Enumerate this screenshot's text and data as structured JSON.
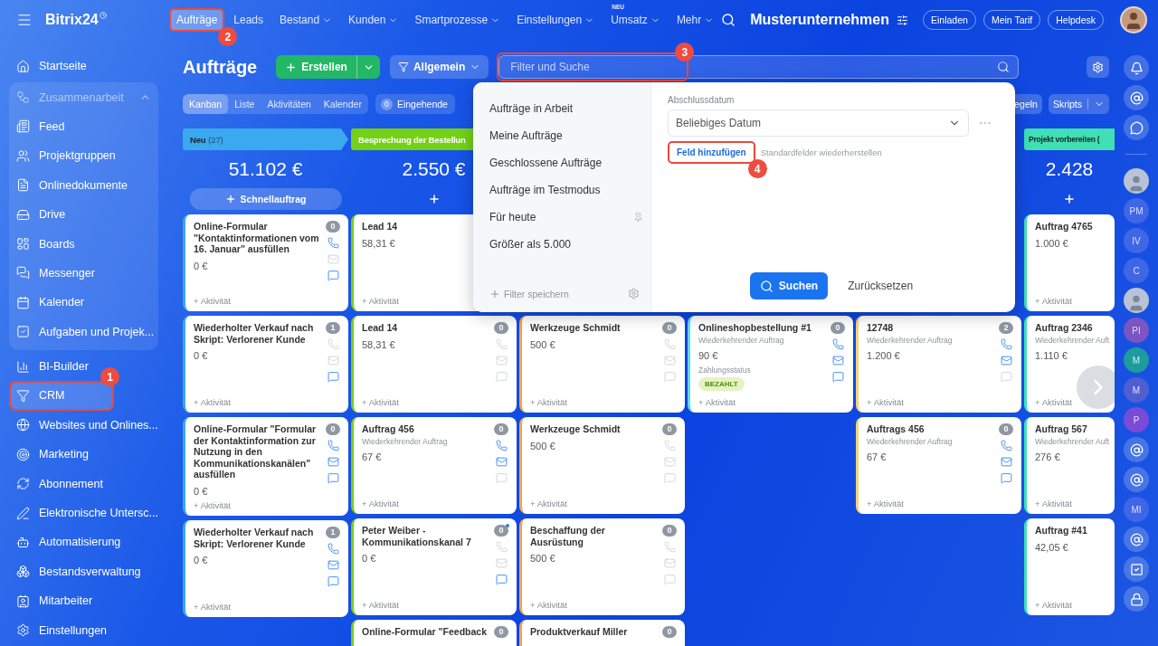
{
  "topbar": {
    "logo": "Bitrix24",
    "nav": [
      {
        "label": "Aufträge",
        "selected": true,
        "dropdown": false,
        "callout": "2"
      },
      {
        "label": "Leads",
        "selected": false,
        "dropdown": false
      },
      {
        "label": "Bestand",
        "selected": false,
        "dropdown": true
      },
      {
        "label": "Kunden",
        "selected": false,
        "dropdown": true
      },
      {
        "label": "Smartprozesse",
        "selected": false,
        "dropdown": true
      },
      {
        "label": "Einstellungen",
        "selected": false,
        "dropdown": true
      },
      {
        "label": "Umsatz",
        "selected": false,
        "dropdown": true,
        "badge": "NEU"
      },
      {
        "label": "Mehr",
        "selected": false,
        "dropdown": true
      }
    ],
    "company": "Musterunternehmen",
    "buttons": [
      "Einladen",
      "Mein Tarif",
      "Helpdesk"
    ]
  },
  "sidebar": {
    "items": [
      {
        "kind": "item",
        "label": "Startseite",
        "selected": false
      },
      {
        "kind": "group",
        "label": "Zusammenarbeit",
        "expanded": true,
        "children": [
          {
            "label": "Feed",
            "selected": false
          },
          {
            "label": "Projektgruppen",
            "selected": false
          },
          {
            "label": "Onlinedokumente",
            "selected": false
          },
          {
            "label": "Drive",
            "selected": false
          },
          {
            "label": "Boards",
            "selected": false
          },
          {
            "label": "Messenger",
            "selected": false
          },
          {
            "label": "Kalender",
            "selected": false
          },
          {
            "label": "Aufgaben und Projek...",
            "selected": false
          }
        ]
      },
      {
        "kind": "item",
        "label": "BI-Builder",
        "selected": false
      },
      {
        "kind": "item",
        "label": "CRM",
        "selected": true,
        "callout": "1"
      },
      {
        "kind": "item",
        "label": "Websites und Onlines...",
        "selected": false
      },
      {
        "kind": "item",
        "label": "Marketing",
        "selected": false
      },
      {
        "kind": "item",
        "label": "Abonnement",
        "selected": false
      },
      {
        "kind": "item",
        "label": "Elektronische Untersc...",
        "selected": false
      },
      {
        "kind": "item",
        "label": "Automatisierung",
        "selected": false
      },
      {
        "kind": "item",
        "label": "Bestandsverwaltung",
        "selected": false
      },
      {
        "kind": "item",
        "label": "Mitarbeiter",
        "selected": false
      },
      {
        "kind": "item",
        "label": "Einstellungen",
        "selected": false
      }
    ]
  },
  "header": {
    "title": "Aufträge",
    "create": "Erstellen",
    "preset": "Allgemein",
    "search": {
      "placeholder": "Filter und Suche",
      "callout": "3"
    }
  },
  "views": [
    {
      "label": "Kanban",
      "selected": true
    },
    {
      "label": "Liste",
      "selected": false
    },
    {
      "label": "Aktivitäten",
      "selected": false
    },
    {
      "label": "Kalender",
      "selected": false
    }
  ],
  "counters": [
    {
      "count": "0",
      "label": "Eingehende"
    }
  ],
  "right_buttons": [
    {
      "label": "egeln",
      "split": false
    },
    {
      "label": "Skripts",
      "split": true
    }
  ],
  "filter_popup": {
    "presets": [
      {
        "label": "Aufträge in Arbeit",
        "pinned": false
      },
      {
        "label": "Meine Aufträge",
        "pinned": false
      },
      {
        "label": "Geschlossene Aufträge",
        "pinned": false
      },
      {
        "label": "Aufträge im Testmodus",
        "pinned": false
      },
      {
        "label": "Für heute",
        "pinned": true
      },
      {
        "label": "Größer als 5.000",
        "pinned": false
      }
    ],
    "save": "Filter speichern",
    "field": {
      "label": "Abschlussdatum",
      "value": "Beliebiges Datum"
    },
    "add_field": {
      "label": "Feld hinzufügen",
      "callout": "4"
    },
    "restore": "Standardfelder wiederherstellen",
    "search_button": "Suchen",
    "reset_button": "Zurücksetzen"
  },
  "columns": [
    {
      "header": {
        "title": "Neu",
        "count": "(27)",
        "dark_text": true
      },
      "color": "#3aa9ef",
      "total": "51.102 €",
      "add_label": "Schnellauftrag",
      "cards": [
        {
          "title": "Online-Formular \"Kontaktinformationen vom 16. Januar\" ausfüllen",
          "amount": "0 €",
          "count": "0",
          "phone": true,
          "mail": false,
          "chat": true,
          "activity": "+ Aktivität"
        },
        {
          "title": "Wiederholter Verkauf nach Skript: Verlorener Kunde",
          "amount": "0 €",
          "count": "1",
          "phone": false,
          "mail": false,
          "chat": true,
          "activity": "+ Aktivität"
        },
        {
          "title": "Online-Formular \"Formular der Kontaktinformation zur Nutzung in den Kommunikationskanälen\" ausfüllen",
          "amount": "0 €",
          "count": "0",
          "phone": true,
          "mail": true,
          "chat": true,
          "activity": "+ Aktivität"
        },
        {
          "title": "Wiederholter Verkauf nach Skript: Verlorener Kunde",
          "amount": "0 €",
          "count": "1",
          "phone": true,
          "mail": true,
          "chat": true,
          "activity": "+ Aktivität"
        }
      ]
    },
    {
      "header": {
        "title": "Besprechung der Bestellun",
        "dark_text": false
      },
      "color": "#74d116",
      "total": "2.550 €",
      "cards": [
        {
          "title": "Lead 14",
          "amount": "58,31 €",
          "activity": "+ Aktivität"
        },
        {
          "title": "Lead 14",
          "amount": "58,31 €",
          "count": "0",
          "phone": false,
          "mail": false,
          "chat": false,
          "activity": "+ Aktivität"
        },
        {
          "title": "Auftrag 456",
          "subtitle": "Wiederkehrender Auftrag",
          "amount": "67 €",
          "count": "0",
          "phone": true,
          "mail": true,
          "chat": false,
          "activity": "+ Aktivität"
        },
        {
          "title": "Peter Weiber - Kommunikationskanal 7",
          "amount": "0 €",
          "count": "0",
          "unread": true,
          "phone": false,
          "mail": false,
          "chat": true,
          "activity": "+ Aktivität"
        },
        {
          "title": "Online-Formular \"Feedback",
          "count": "0"
        }
      ]
    },
    {
      "color": "#f5a348",
      "cards": [
        {
          "title": "Werkzeuge Schmidt",
          "amount": "500 €",
          "count": "0",
          "phone": false,
          "mail": false,
          "chat": false,
          "activity": "+ Aktivität"
        },
        {
          "title": "Werkzeuge Schmidt",
          "amount": "500 €",
          "count": "0",
          "phone": false,
          "mail": false,
          "chat": false,
          "activity": "+ Aktivität"
        },
        {
          "title": "Beschaffung der Ausrüstung",
          "amount": "500 €",
          "count": "0",
          "phone": false,
          "mail": false,
          "chat": false,
          "activity": "+ Aktivität"
        },
        {
          "title": "Produktverkauf Miller",
          "count": "0"
        }
      ]
    },
    {
      "color": "#62d8f4",
      "cards": [
        {
          "title": "Onlineshopbestellung #1",
          "subtitle": "Wiederkehrender Auftrag",
          "amount": "90 €",
          "status": {
            "label": "Zahlungsstatus",
            "badge": "BEZAHLT"
          },
          "count": "0",
          "phone": true,
          "mail": true,
          "chat": true,
          "activity": "+ Aktivität"
        }
      ]
    },
    {
      "color": "#f3d27a",
      "cards": [
        {
          "title": "12748",
          "subtitle": "Wiederkehrender Auftrag",
          "amount": "1.200 €",
          "count": "2",
          "phone": true,
          "mail": true,
          "chat": false,
          "activity": "+ Aktivität"
        },
        {
          "title": "Auftrags 456",
          "subtitle": "Wiederkehrender Auftrag",
          "amount": "67 €",
          "count": "0",
          "phone": true,
          "mail": true,
          "chat": true,
          "activity": "+ Aktivität"
        }
      ]
    },
    {
      "header": {
        "title": "Projekt vorbereiten (",
        "dark_text": true
      },
      "color": "#3ee0b4",
      "total": "2.428",
      "cards": [
        {
          "title": "Auftrag 4765",
          "amount": "1.000 €",
          "activity": "+ Aktivität"
        },
        {
          "title": "Auftrag 2346",
          "subtitle": "Wiederkehrender Auft",
          "amount": "1.110 €",
          "activity": "+ Aktivität"
        },
        {
          "title": "Auftrag 567",
          "subtitle": "Wiederkehrender Auft",
          "amount": "276 €",
          "activity": "+ Aktivität"
        },
        {
          "title": "Auftrag #41",
          "amount": "42,05 €",
          "activity": "+ Aktivität"
        }
      ]
    }
  ],
  "right_rail": [
    {
      "kind": "icon"
    },
    {
      "kind": "icon"
    },
    {
      "kind": "icon"
    },
    {
      "kind": "photo"
    },
    {
      "kind": "initials",
      "text": "PM",
      "color": "#3f66e6"
    },
    {
      "kind": "initials",
      "text": "IV",
      "color": "#3f66e6"
    },
    {
      "kind": "initials",
      "text": "C",
      "color": "#3f66e6"
    },
    {
      "kind": "photo"
    },
    {
      "kind": "initials",
      "text": "PI",
      "color": "#7c55c4"
    },
    {
      "kind": "initials",
      "text": "M",
      "color": "#1c9c9c"
    },
    {
      "kind": "initials",
      "text": "M",
      "color": "#4f5fd2"
    },
    {
      "kind": "initials",
      "text": "P",
      "color": "#7a4bd6"
    },
    {
      "kind": "icon"
    },
    {
      "kind": "icon"
    },
    {
      "kind": "initials",
      "text": "MI",
      "color": "#3f66e6"
    },
    {
      "kind": "icon"
    },
    {
      "kind": "icon"
    },
    {
      "kind": "icon"
    }
  ]
}
